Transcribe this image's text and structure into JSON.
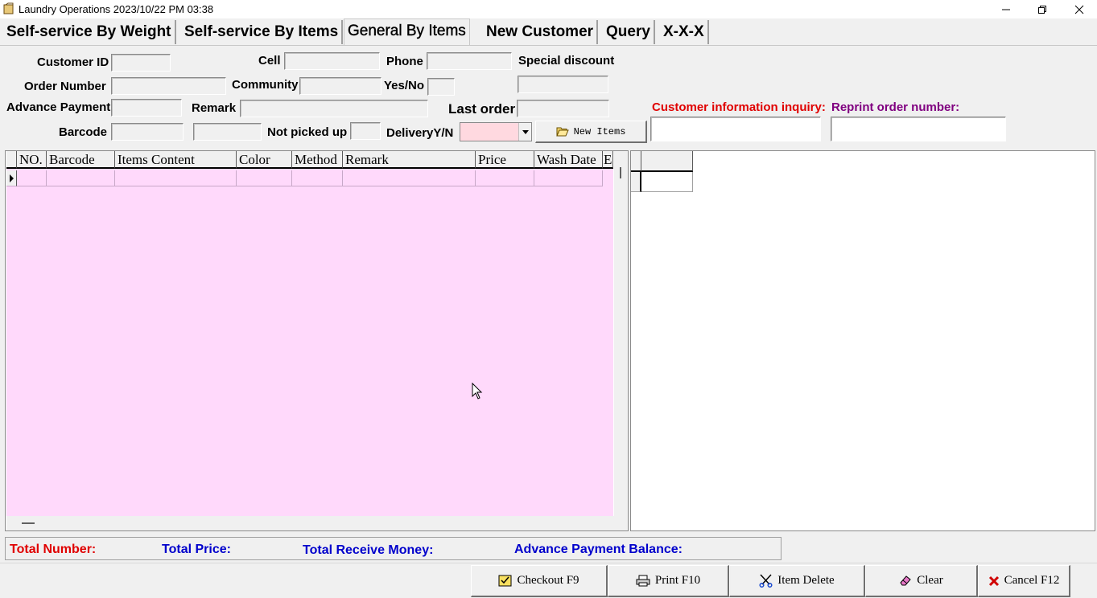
{
  "window": {
    "title": "Laundry  Operations   2023/10/22 PM 03:38"
  },
  "tabs": [
    {
      "label": "Self-service By Weight"
    },
    {
      "label": "Self-service By Items"
    },
    {
      "label": "General By Items"
    },
    {
      "label": "New Customer"
    },
    {
      "label": "Query"
    },
    {
      "label": "X-X-X"
    }
  ],
  "form": {
    "customer_id": "Customer ID",
    "cell": "Cell",
    "phone": "Phone",
    "special_discount": "Special discount",
    "order_number": "Order Number",
    "community": "Community",
    "yes_no": "Yes/No",
    "advance_payment": "Advance Payment",
    "remark": "Remark",
    "last_order": "Last order",
    "barcode": "Barcode",
    "not_picked_up": "Not picked up",
    "delivery": "DeliveryY/N",
    "new_items_button": "New  Items",
    "customer_inquiry": "Customer information inquiry:",
    "reprint_order": "Reprint order number:"
  },
  "grid": {
    "columns": [
      "NO.",
      "Barcode",
      "Items Content",
      "Color",
      "Method",
      "Remark",
      "Price",
      "Wash Date",
      "E"
    ]
  },
  "totals": {
    "total_number": "Total Number:",
    "total_price": "Total Price:",
    "total_receive": "Total Receive Money:",
    "advance_balance": "Advance Payment Balance:"
  },
  "buttons": {
    "checkout": "Checkout F9",
    "print": "Print F10",
    "item_delete": "Item Delete",
    "clear": "Clear",
    "cancel": "Cancel F12"
  },
  "colors": {
    "grid_background": "#ffd9fb",
    "delivery_combo": "#ffd9e0",
    "red_label": "#e00000",
    "blue_label": "#0000cc",
    "purple_label": "#800080"
  }
}
